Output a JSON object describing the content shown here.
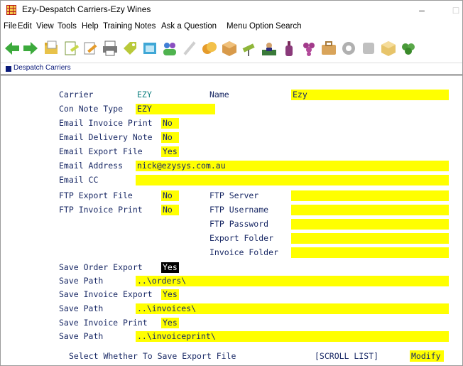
{
  "window": {
    "title": "Ezy-Despatch Carriers-Ezy Wines",
    "minimize_glyph": "–",
    "maximize_glyph": "□"
  },
  "menu": [
    "File",
    "Edit",
    "View",
    "Tools",
    "Help",
    "Training Notes",
    "Ask a Question",
    "Menu Option Search"
  ],
  "toolbar_icons": [
    "back-arrow-icon",
    "forward-arrow-icon",
    "open-folder-icon",
    "edit-document-icon",
    "pen-icon",
    "printer-icon",
    "tag-icon",
    "window-icon",
    "people-icon",
    "pencil-icon",
    "coins-icon",
    "package-icon",
    "telescope-icon",
    "worker-icon",
    "bottle-icon",
    "grapes-icon",
    "briefcase-icon",
    "gear-icon",
    "stop-icon",
    "box-icon",
    "plant-icon"
  ],
  "tab": {
    "label": "Despatch Carriers"
  },
  "form": {
    "carrier_label": "Carrier",
    "carrier_value": "EZY",
    "name_label": "Name",
    "name_value": "Ezy",
    "con_note_type_label": "Con Note Type",
    "con_note_type_value": "EZY",
    "email_invoice_print_label": "Email Invoice Print",
    "email_invoice_print_value": "No",
    "email_delivery_note_label": "Email Delivery Note",
    "email_delivery_note_value": "No",
    "email_export_file_label": "Email Export File",
    "email_export_file_value": "Yes",
    "email_address_label": "Email Address",
    "email_address_value": "nick@ezysys.com.au",
    "email_cc_label": "Email CC",
    "email_cc_value": "",
    "ftp_export_file_label": "FTP Export File",
    "ftp_export_file_value": "No",
    "ftp_invoice_print_label": "FTP Invoice Print",
    "ftp_invoice_print_value": "No",
    "ftp_server_label": "FTP Server",
    "ftp_server_value": "",
    "ftp_username_label": "FTP Username",
    "ftp_username_value": "",
    "ftp_password_label": "FTP Password",
    "ftp_password_value": "",
    "export_folder_label": "Export Folder",
    "export_folder_value": "",
    "invoice_folder_label": "Invoice Folder",
    "invoice_folder_value": "",
    "save_order_export_label": "Save Order Export",
    "save_order_export_value": "Yes",
    "save_path_1_label": "Save Path",
    "save_path_1_value": "..\\orders\\",
    "save_invoice_export_label": "Save Invoice Export",
    "save_invoice_export_value": "Yes",
    "save_path_2_label": "Save Path",
    "save_path_2_value": "..\\invoices\\",
    "save_invoice_print_label": "Save Invoice Print",
    "save_invoice_print_value": "Yes",
    "save_path_3_label": "Save Path",
    "save_path_3_value": "..\\invoiceprint\\"
  },
  "status": {
    "prompt": "Select Whether To Save Export File",
    "scroll_list": "[SCROLL LIST]",
    "mode": "Modify"
  },
  "colors": {
    "field_bg": "#ffff00",
    "label_text": "#1a2a66",
    "carrier_code_text": "#0f8080",
    "active_field_bg": "#000000"
  }
}
